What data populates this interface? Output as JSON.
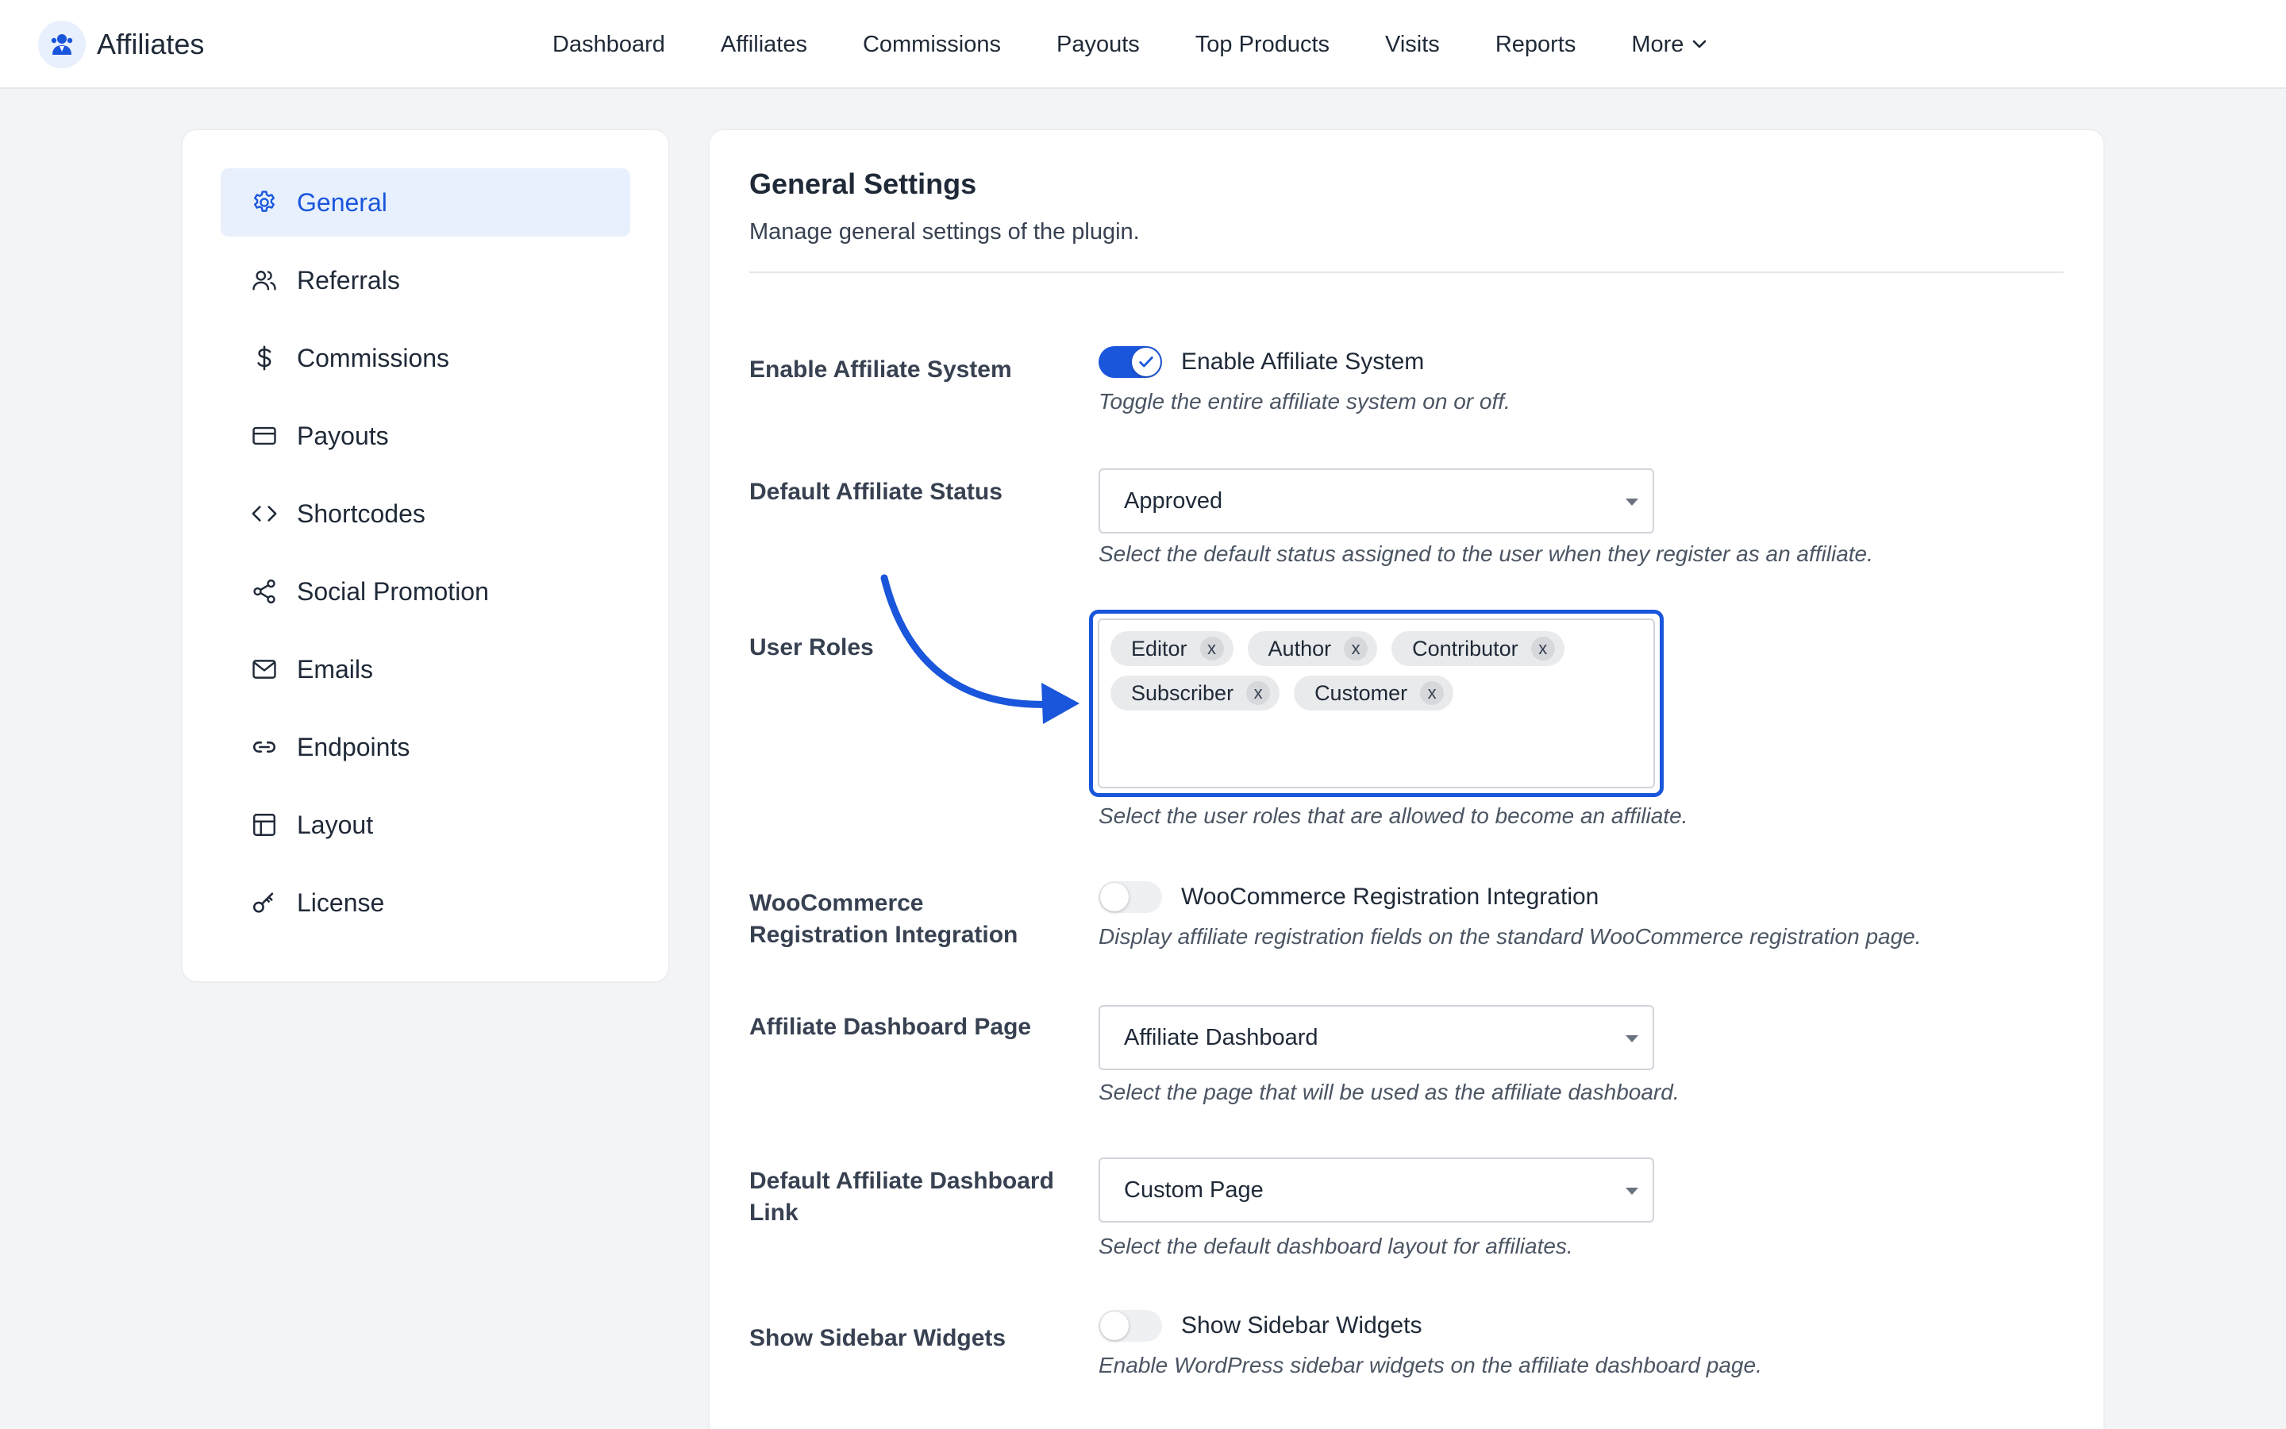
{
  "app": {
    "name": "Affiliates",
    "logo_icon": "affiliate-logo-icon"
  },
  "nav": {
    "items": [
      "Dashboard",
      "Affiliates",
      "Commissions",
      "Payouts",
      "Top Products",
      "Visits",
      "Reports"
    ],
    "more_label": "More"
  },
  "sidebar": {
    "items": [
      {
        "label": "General",
        "icon": "gear-icon",
        "active": true
      },
      {
        "label": "Referrals",
        "icon": "users-icon"
      },
      {
        "label": "Commissions",
        "icon": "dollar-icon"
      },
      {
        "label": "Payouts",
        "icon": "credit-card-icon"
      },
      {
        "label": "Shortcodes",
        "icon": "code-icon"
      },
      {
        "label": "Social Promotion",
        "icon": "share-icon"
      },
      {
        "label": "Emails",
        "icon": "mail-icon"
      },
      {
        "label": "Endpoints",
        "icon": "link-icon"
      },
      {
        "label": "Layout",
        "icon": "layout-icon"
      },
      {
        "label": "License",
        "icon": "key-icon"
      }
    ]
  },
  "main": {
    "title": "General Settings",
    "subtitle": "Manage general settings of the plugin.",
    "enable_affiliate": {
      "label": "Enable Affiliate System",
      "toggle_text": "Enable Affiliate System",
      "help": "Toggle the entire affiliate system on or off.",
      "enabled": true
    },
    "default_status": {
      "label": "Default Affiliate Status",
      "value": "Approved",
      "help": "Select the default status assigned to the user when they register as an affiliate."
    },
    "user_roles": {
      "label": "User Roles",
      "tags": [
        "Editor",
        "Author",
        "Contributor",
        "Subscriber",
        "Customer"
      ],
      "remove_symbol": "x",
      "help": "Select the user roles that are allowed to become an affiliate."
    },
    "woocommerce": {
      "label": "WooCommerce Registration Integration",
      "toggle_text": "WooCommerce Registration Integration",
      "help": "Display affiliate registration fields on the standard WooCommerce registration page.",
      "enabled": false
    },
    "dashboard_page": {
      "label": "Affiliate Dashboard Page",
      "value": "Affiliate Dashboard",
      "help": "Select the page that will be used as the affiliate dashboard."
    },
    "dashboard_link": {
      "label": "Default Affiliate Dashboard Link",
      "value": "Custom Page",
      "help": "Select the default dashboard layout for affiliates."
    },
    "sidebar_widgets": {
      "label": "Show Sidebar Widgets",
      "toggle_text": "Show Sidebar Widgets",
      "help": "Enable WordPress sidebar widgets on the affiliate dashboard page.",
      "enabled": false
    }
  },
  "colors": {
    "accent": "#1a56db",
    "background": "#f3f4f6",
    "active_bg": "#e8f0fe"
  }
}
